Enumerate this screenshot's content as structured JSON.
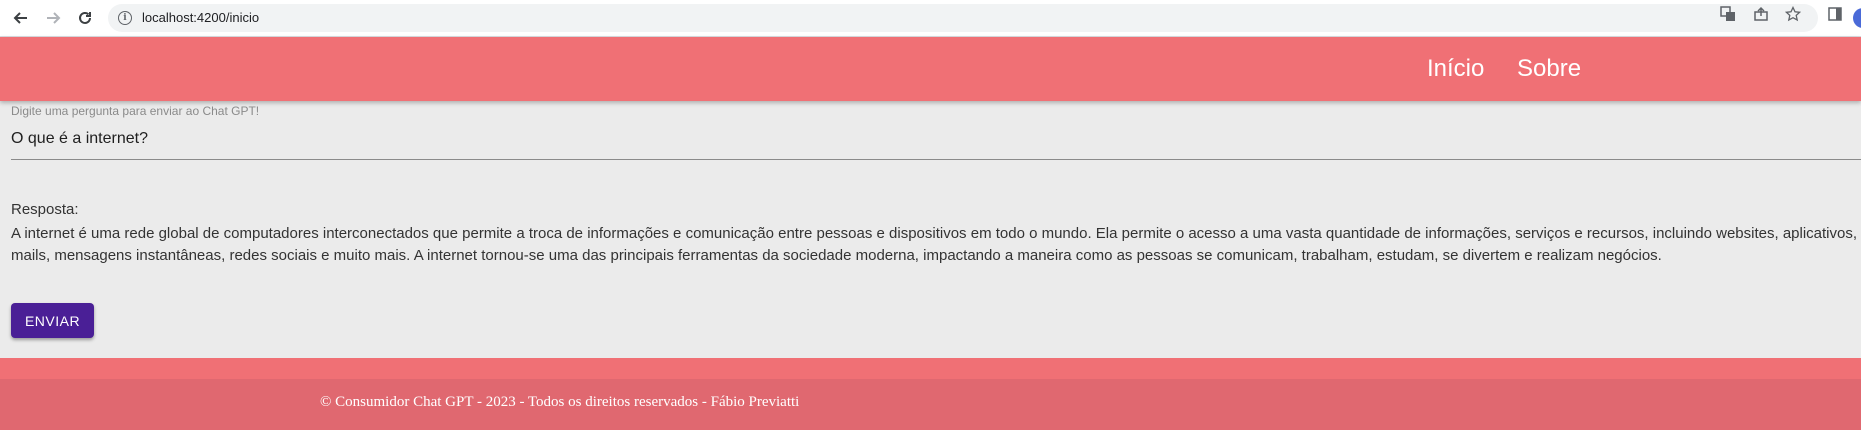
{
  "browser": {
    "url": "localhost:4200/inicio",
    "icons": {
      "back": "arrow-left-icon",
      "forward": "arrow-right-icon",
      "reload": "reload-icon",
      "site_info": "info-icon",
      "translate": "translate-icon",
      "share": "share-icon",
      "bookmark": "star-icon",
      "side_panel": "side-panel-icon"
    }
  },
  "header": {
    "background": "#f07075",
    "nav": [
      {
        "label": "Início"
      },
      {
        "label": "Sobre"
      }
    ]
  },
  "form": {
    "question_label": "Digite uma pergunta para enviar ao Chat GPT!",
    "question_value": "O que é a internet?",
    "response_label": "Resposta:",
    "response_lines": [
      "A internet é uma rede global de computadores interconectados que permite a troca de informações e comunicação entre pessoas e dispositivos em todo o mundo. Ela permite o acesso a uma vasta quantidade de informações, serviços e recursos, incluindo websites, aplicativos, e-",
      "mails, mensagens instantâneas, redes sociais e muito mais. A internet tornou-se uma das principais ferramentas da sociedade moderna, impactando a maneira como as pessoas se comunicam, trabalham, estudam, se divertem e realizam negócios."
    ],
    "send_label": "ENVIAR",
    "send_color": "#4a1f96"
  },
  "footer": {
    "text": "© Consumidor Chat GPT - 2023 - Todos os direitos reservados - Fábio Previatti",
    "background": "#e06870"
  }
}
